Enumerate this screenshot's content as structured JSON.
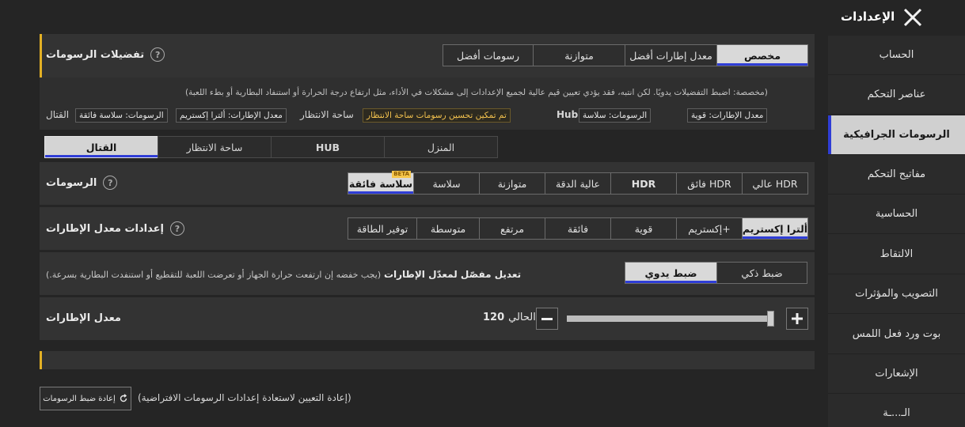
{
  "header": {
    "title": "الإعدادات",
    "close_icon": "close-icon"
  },
  "sidebar": {
    "items": [
      {
        "label": "الحساب",
        "active": false
      },
      {
        "label": "عناصر التحكم",
        "active": false
      },
      {
        "label": "الرسومات الجرافيكية",
        "active": true
      },
      {
        "label": "مفاتيح التحكم",
        "active": false
      },
      {
        "label": "الحساسية",
        "active": false
      },
      {
        "label": "الالتقاط",
        "active": false
      },
      {
        "label": "التصويب والمؤثرات",
        "active": false
      },
      {
        "label": "بوت ورد فعل اللمس",
        "active": false
      },
      {
        "label": "الإشعارات",
        "active": false
      },
      {
        "label": "الـ...ـة",
        "active": false
      }
    ]
  },
  "preferences": {
    "title": "تفضيلات الرسومات",
    "options": [
      "مخصص",
      "معدل إطارات أفضل",
      "متوازنة",
      "رسومات أفضل"
    ],
    "selected": "مخصص",
    "description": "(مخصصة: اضبط التفضيلات يدويًا. لكن انتبه، فقد يؤدي تعيين قيم عالية لجميع الإعدادات إلى مشكلات في الأداء، مثل ارتفاع درجة الحرارة أو استنفاد البطارية أو بطء اللعبة)",
    "hub_label": "Hub",
    "hub_fps": "معدل الإطارات: قوية",
    "hub_graphics": "الرسومات: سلاسة",
    "lobby_label": "ساحة الانتظار",
    "lobby_note": "تم تمكين تحسين رسومات ساحة الانتظار",
    "battle_label": "القتال",
    "battle_fps": "معدل الإطارات: ألترا إكستريم",
    "battle_graphics": "الرسومات: سلاسة فائقة"
  },
  "tabs": [
    "المنزل",
    "HUB",
    "ساحة الانتظار",
    "القتال"
  ],
  "active_tab": "القتال",
  "graphics": {
    "title": "الرسومات",
    "options": [
      "عالي HDR",
      "فائق HDR",
      "HDR",
      "عالية الدقة",
      "متوازنة",
      "سلاسة",
      "سلاسة فائقة"
    ],
    "selected": "سلاسة فائقة",
    "beta": "BETA"
  },
  "fps": {
    "title": "إعدادات معدل الإطارات",
    "options": [
      "ألترا إكستريم",
      "إكستريم+",
      "قوية",
      "فائقة",
      "مرتفع",
      "متوسطة",
      "توفير الطاقة"
    ],
    "selected": "ألترا إكستريم"
  },
  "adaptive": {
    "title": "تعديل مفصّل لمعدّل الإطارات",
    "note": "(يجب خفضه إن ارتفعت حرارة الجهاز أو تعرضت اللعبة للتقطيع أو استنفدت البطارية بسرعة.)",
    "options": [
      "ضبط ذكي",
      "ضبط يدوي"
    ],
    "selected": "ضبط يدوي"
  },
  "frame_rate": {
    "title": "معدل الإطارات",
    "current_label": "الحالي:",
    "current_value": "120",
    "slider_fraction": 0.98
  },
  "reset": {
    "button_label": "إعادة ضبط الرسومات",
    "description": "(إعادة التعيين لاستعادة إعدادات الرسومات الافتراضية)"
  },
  "colors": {
    "accent_blue": "#2f3dd6",
    "accent_yellow": "#e3b024",
    "highlight_text": "#f2c14e"
  }
}
